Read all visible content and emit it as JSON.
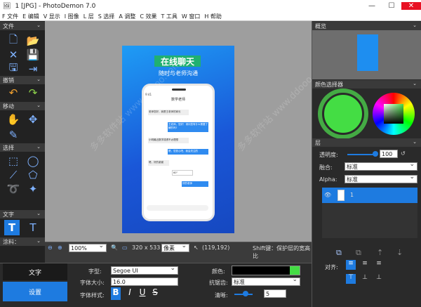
{
  "window": {
    "title": "1 [JPG]  -  PhotoDemon 7.0",
    "min": "—",
    "max": "☐",
    "close": "✕"
  },
  "menu": [
    "F 文件",
    "E 编辑",
    "V 显示",
    "I 图像",
    "L 层",
    "S 选择",
    "A 调整",
    "C 效果",
    "T 工具",
    "W 窗口",
    "H 帮助"
  ],
  "left": {
    "file": "文件",
    "undo": "撤销",
    "move": "移动",
    "select": "选择",
    "text": "文字",
    "paint": "涂料："
  },
  "canvas": {
    "headline": "在线聊天",
    "subhead": "随时与老师沟通",
    "phone_time": "9:41",
    "contact": "数学老师",
    "msgs": [
      "老师您好，我是王老师的家长",
      "王老师，您好！请问您有什么需要了解的吗?",
      "小明最近数学成绩不太理想",
      "嗯，您放心吧，我会关注的",
      "嗯，好的谢谢",
      "好的老师"
    ],
    "audio": "60\"",
    "watermark": "多多软件站 www.ddooo.com"
  },
  "status": {
    "zoom": "100%",
    "size": "320 x 533",
    "unit": "像素",
    "coords": "(119,192)",
    "hint": "Shift键：保护层的宽高比"
  },
  "right": {
    "overview": "概览",
    "picker": "颜色选择器",
    "layers": "层",
    "opacity_label": "透明度:",
    "opacity": "100",
    "blend_label": "融合:",
    "blend": "标准",
    "alpha_label": "Alpha:",
    "alpha": "标准",
    "layer_name": "1",
    "align": "对齐:"
  },
  "bottom": {
    "tab_text": "文字",
    "tab_settings": "设置",
    "font_label": "字型:",
    "font": "Segoe UI",
    "size_label": "字体大小:",
    "size": "16.0",
    "style_label": "字体样式:",
    "b": "B",
    "i": "I",
    "u": "U",
    "s": "S",
    "color_label": "颜色:",
    "aa_label": "抗锯齿:",
    "aa": "标准",
    "clear_label": "清晰:",
    "clear": "5"
  },
  "colors": {
    "accent": "#1e7be0",
    "green": "#44dd44"
  }
}
